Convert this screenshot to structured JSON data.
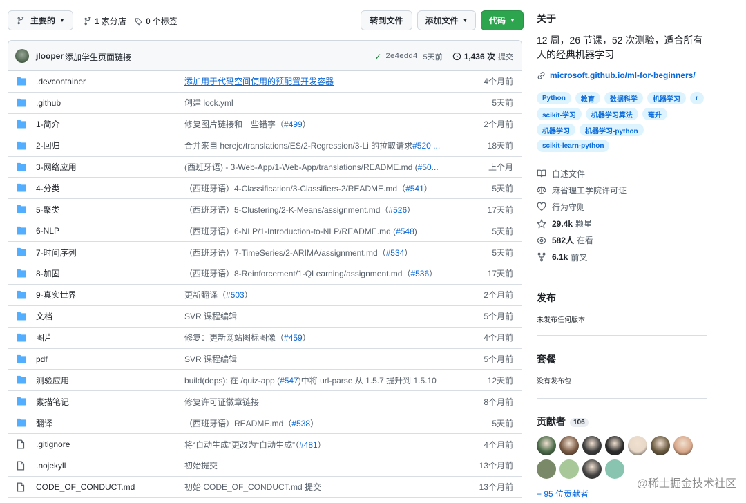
{
  "toolbar": {
    "branch_label": "主要的",
    "branches_count": "1",
    "branches_label": "家分店",
    "tags_count": "0",
    "tags_label": "个标签",
    "goto_file_label": "转到文件",
    "add_file_label": "添加文件",
    "code_label": "代码"
  },
  "commit": {
    "author": "jlooper",
    "message": "添加学生页面链接",
    "sha": "2e4edd4",
    "ago": "5天前",
    "history_count": "1,436 次",
    "history_label": "提交"
  },
  "files": [
    {
      "type": "folder",
      "name": ".devcontainer",
      "msg": "添加用于代码空间使用的预配置开发容器",
      "pr": "",
      "msg_end": "",
      "linked": true,
      "time": "4个月前"
    },
    {
      "type": "folder",
      "name": ".github",
      "msg": "创建 lock.yml",
      "pr": "",
      "msg_end": "",
      "linked": false,
      "time": "5天前"
    },
    {
      "type": "folder",
      "name": "1-简介",
      "msg": "修复图片链接和一些错字（",
      "pr": "#499",
      "msg_end": "）",
      "linked": false,
      "time": "2个月前"
    },
    {
      "type": "folder",
      "name": "2-回归",
      "msg": "合并来自 hereje/translations/ES/2-Regression/3-Li 的拉取请求",
      "pr": "#520 ...",
      "msg_end": "",
      "linked": false,
      "time": "18天前"
    },
    {
      "type": "folder",
      "name": "3-网络应用",
      "msg": "(西班牙语) - 3-Web-App/1-Web-App/translations/README.md (",
      "pr": "#50...",
      "msg_end": "",
      "linked": false,
      "time": "上个月"
    },
    {
      "type": "folder",
      "name": "4-分类",
      "msg": "（西班牙语）4-Classification/3-Classifiers-2/README.md（",
      "pr": "#541",
      "msg_end": "）",
      "linked": false,
      "time": "5天前"
    },
    {
      "type": "folder",
      "name": "5-聚类",
      "msg": "（西班牙语）5-Clustering/2-K-Means/assignment.md（",
      "pr": "#526",
      "msg_end": "）",
      "linked": false,
      "time": "17天前"
    },
    {
      "type": "folder",
      "name": "6-NLP",
      "msg": "（西班牙语）6-NLP/1-Introduction-to-NLP/README.md (",
      "pr": "#548",
      "msg_end": ")",
      "linked": false,
      "time": "5天前"
    },
    {
      "type": "folder",
      "name": "7-时间序列",
      "msg": "（西班牙语）7-TimeSeries/2-ARIMA/assignment.md（",
      "pr": "#534",
      "msg_end": "）",
      "linked": false,
      "time": "5天前"
    },
    {
      "type": "folder",
      "name": "8-加固",
      "msg": "（西班牙语）8-Reinforcement/1-QLearning/assignment.md（",
      "pr": "#536",
      "msg_end": "）",
      "linked": false,
      "time": "17天前"
    },
    {
      "type": "folder",
      "name": "9-真实世界",
      "msg": "更新翻译（",
      "pr": "#503",
      "msg_end": "）",
      "linked": false,
      "time": "2个月前"
    },
    {
      "type": "folder",
      "name": "文档",
      "msg": "SVR 课程编辑",
      "pr": "",
      "msg_end": "",
      "linked": false,
      "time": "5个月前"
    },
    {
      "type": "folder",
      "name": "图片",
      "msg": "修复：更新网站图标图像（",
      "pr": "#459",
      "msg_end": "）",
      "linked": false,
      "time": "4个月前"
    },
    {
      "type": "folder",
      "name": "pdf",
      "msg": "SVR 课程编辑",
      "pr": "",
      "msg_end": "",
      "linked": false,
      "time": "5个月前"
    },
    {
      "type": "folder",
      "name": "测验应用",
      "msg": "build(deps): 在 /quiz-app (",
      "pr": "#547",
      "msg_end": ")中将 url-parse 从 1.5.7 提升到 1.5.10",
      "linked": false,
      "time": "12天前"
    },
    {
      "type": "folder",
      "name": "素描笔记",
      "msg": "修复许可证徽章链接",
      "pr": "",
      "msg_end": "",
      "linked": false,
      "time": "8个月前"
    },
    {
      "type": "folder",
      "name": "翻译",
      "msg": "（西班牙语）README.md（",
      "pr": "#538",
      "msg_end": "）",
      "linked": false,
      "time": "5天前"
    },
    {
      "type": "file",
      "name": ".gitignore",
      "msg": "将“自动生成”更改为“自动生成”（",
      "pr": "#481",
      "msg_end": "）",
      "linked": false,
      "time": "4个月前"
    },
    {
      "type": "file",
      "name": ".nojekyll",
      "msg": "初始提交",
      "pr": "",
      "msg_end": "",
      "linked": false,
      "time": "13个月前"
    },
    {
      "type": "file",
      "name": "CODE_OF_CONDUCT.md",
      "msg": "初始 CODE_OF_CONDUCT.md 提交",
      "pr": "",
      "msg_end": "",
      "linked": false,
      "time": "13个月前"
    }
  ],
  "about": {
    "title": "关于",
    "description": "12 周，26 节课，52 次测验，适合所有人的经典机器学习",
    "link": "microsoft.github.io/ml-for-beginners/",
    "topics": [
      "Python",
      "教育",
      "数据科学",
      "机器学习",
      "r",
      "scikit-学习",
      "机器学习算法",
      "毫升",
      "机器学习",
      "机器学习-python",
      "scikit-learn-python"
    ],
    "readme": "自述文件",
    "license": "麻省理工学院许可证",
    "conduct": "行为守则",
    "stars_count": "29.4k",
    "stars_label": "颗星",
    "watchers_count": "582人",
    "watchers_label": "在看",
    "forks_count": "6.1k",
    "forks_label": "前叉"
  },
  "releases": {
    "title": "发布",
    "note": "未发布任何版本"
  },
  "packages": {
    "title": "套餐",
    "note": "没有发布包"
  },
  "contributors": {
    "title": "贡献者",
    "count": "106",
    "more": "+ 95 位贡献者",
    "avatar_colors": [
      "#4a6b48",
      "#7a5a44",
      "#3c3c3c",
      "#2b2b2b",
      "#e8d8c8",
      "#6a5a40",
      "#d9a88a",
      "#7a8a68",
      "#a8c89a",
      "#444444",
      "#88c4b0"
    ]
  },
  "watermark": "@稀土掘金技术社区"
}
